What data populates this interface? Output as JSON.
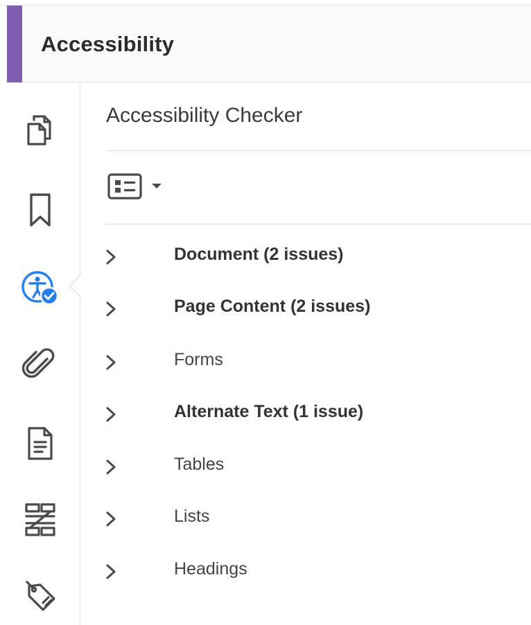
{
  "header": {
    "title": "Accessibility"
  },
  "panel": {
    "title": "Accessibility Checker"
  },
  "rail": {
    "icons": [
      "pages-icon",
      "bookmark-icon",
      "accessibility-check-icon",
      "attachment-icon",
      "document-icon",
      "content-reorder-icon",
      "tags-icon"
    ],
    "active": "accessibility-check-icon"
  },
  "toolbar": {
    "options_icon": "list-options-icon",
    "dropdown_icon": "caret-down-icon"
  },
  "tree": {
    "items": [
      {
        "label": "Document (2 issues)",
        "bold": true
      },
      {
        "label": "Page Content (2 issues)",
        "bold": true
      },
      {
        "label": "Forms",
        "bold": false
      },
      {
        "label": "Alternate Text (1 issue)",
        "bold": true
      },
      {
        "label": "Tables",
        "bold": false
      },
      {
        "label": "Lists",
        "bold": false
      },
      {
        "label": "Headings",
        "bold": false
      }
    ]
  },
  "colors": {
    "accent": "#7e5fb0",
    "active_icon": "#2680eb"
  }
}
